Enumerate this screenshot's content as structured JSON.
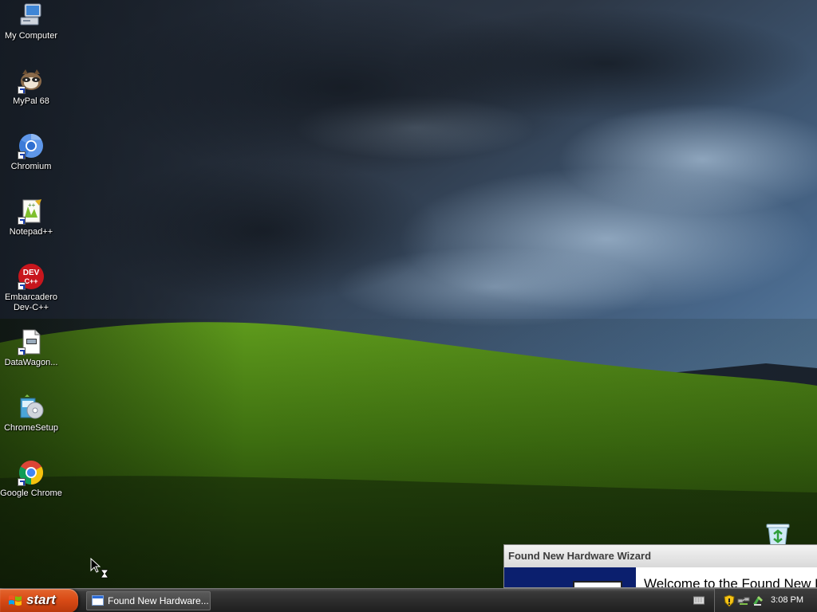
{
  "desktop": {
    "icons": [
      {
        "label": "My Computer",
        "icon": "my-computer-icon"
      },
      {
        "label": "MyPal 68",
        "icon": "mypal-icon"
      },
      {
        "label": "Chromium",
        "icon": "chromium-icon"
      },
      {
        "label": "Notepad++",
        "icon": "notepad-plus-plus-icon"
      },
      {
        "label": "Embarcadero Dev-C++",
        "icon": "dev-cpp-icon"
      },
      {
        "label": "DataWagon...",
        "icon": "datawagon-icon"
      },
      {
        "label": "ChromeSetup",
        "icon": "chrome-setup-icon"
      },
      {
        "label": "Google Chrome",
        "icon": "google-chrome-icon"
      }
    ],
    "dev_badge": "DEV",
    "dev_badge_sub": "C++",
    "recycle_bin_icon": "recycle-bin-icon"
  },
  "wizard": {
    "title": "Found New Hardware Wizard",
    "heading": "Welcome to the Found New Hardware Wizard"
  },
  "taskbar": {
    "start_label": "start",
    "task_button": "Found New Hardware...",
    "clock": "3:08 PM",
    "tray_icons": [
      "keyboard-icon",
      "security-shield-icon",
      "network-icon",
      "safely-remove-icon"
    ]
  },
  "colors": {
    "start_orange": "#d94b16",
    "wizard_side_blue": "#0b1f6e",
    "sky_dark": "#2a3442",
    "hill_green": "#4f8a14"
  }
}
